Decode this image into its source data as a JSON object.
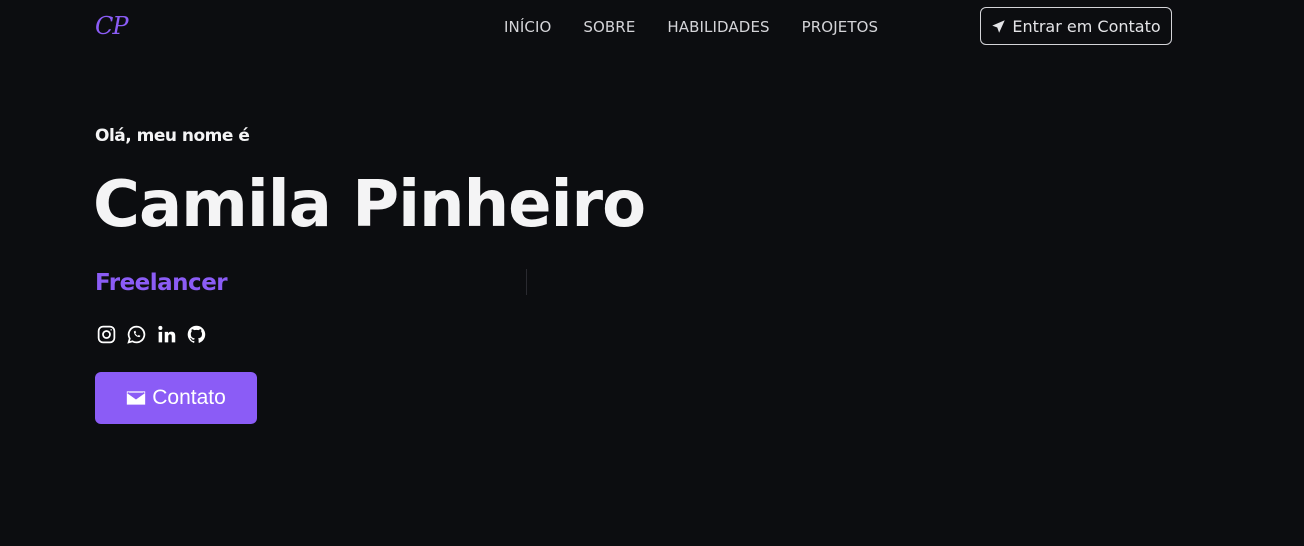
{
  "header": {
    "logo": "CP",
    "nav": [
      "INÍCIO",
      "SOBRE",
      "HABILIDADES",
      "PROJETOS"
    ],
    "contact_button": {
      "label": "Entrar em Contato",
      "icon": "send-icon"
    }
  },
  "hero": {
    "greeting": "Olá, meu nome é",
    "name": "Camila Pinheiro",
    "role": "Freelancer",
    "socials": [
      "instagram-icon",
      "whatsapp-icon",
      "linkedin-icon",
      "github-icon"
    ],
    "cta": {
      "label": "Contato",
      "icon": "mail-icon"
    }
  },
  "colors": {
    "background": "#0c0d10",
    "accent": "#8b5cf6",
    "text": "#f4f4f5"
  }
}
